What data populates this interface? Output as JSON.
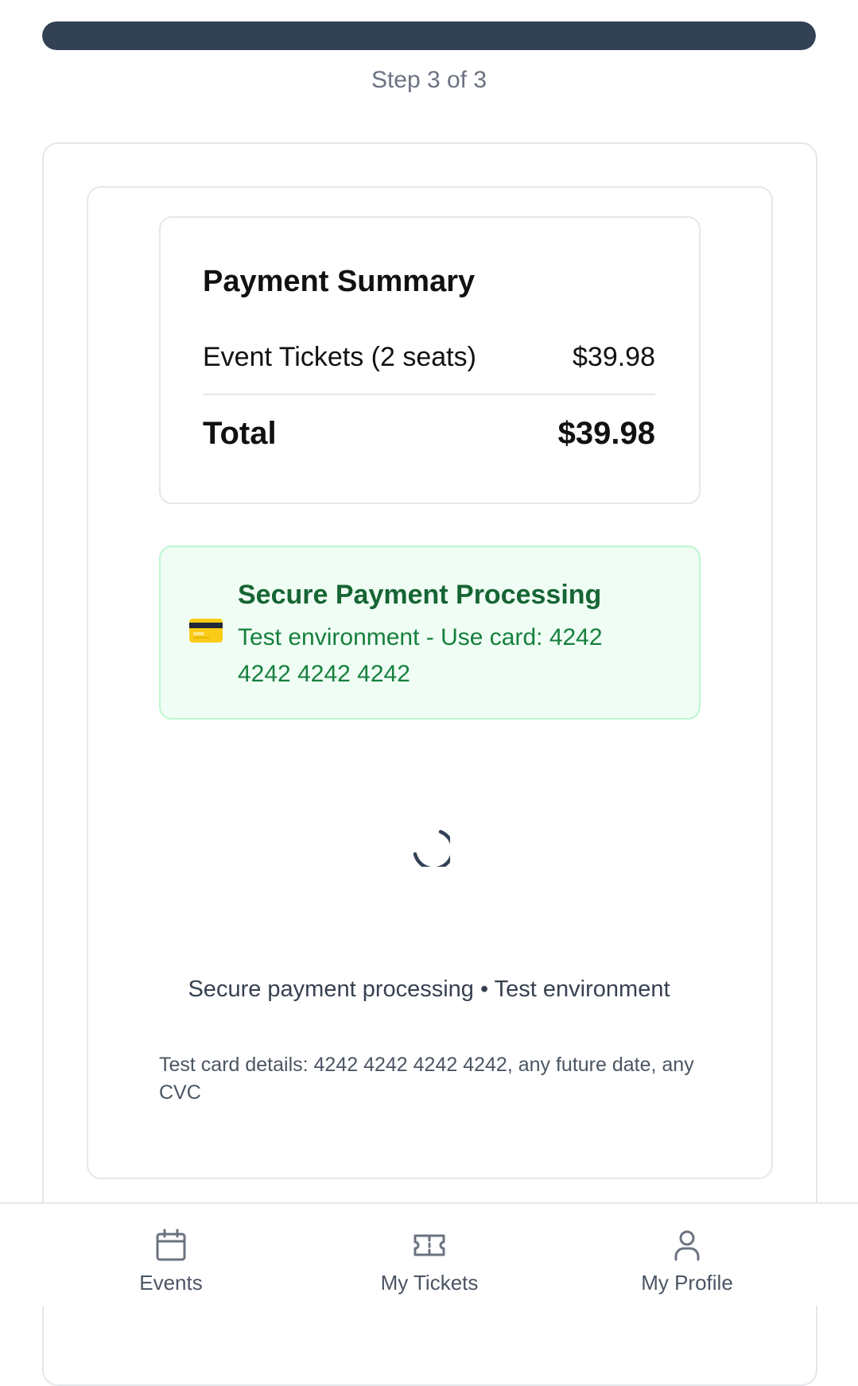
{
  "progress": {
    "fraction": 1.0,
    "step_label": "Step 3 of 3"
  },
  "summary": {
    "title": "Payment Summary",
    "line_item_label": "Event Tickets (2 seats)",
    "line_item_amount": "$39.98",
    "total_label": "Total",
    "total_amount": "$39.98"
  },
  "secure": {
    "icon": "credit-card-icon",
    "title": "Secure Payment Processing",
    "text": "Test environment - Use card: 4242 4242 4242 4242"
  },
  "loading": {
    "icon": "spinner-icon"
  },
  "footer": {
    "note": "Secure payment processing • Test environment",
    "test_details": "Test card details: 4242 4242 4242 4242, any future date, any CVC"
  },
  "nav": {
    "items": [
      {
        "label": "Events",
        "icon": "calendar-icon"
      },
      {
        "label": "My Tickets",
        "icon": "ticket-icon"
      },
      {
        "label": "My Profile",
        "icon": "user-icon"
      }
    ]
  },
  "colors": {
    "progress": "#334155",
    "secure_bg": "#f0fdf4",
    "secure_title": "#166534",
    "secure_text": "#15803d"
  }
}
